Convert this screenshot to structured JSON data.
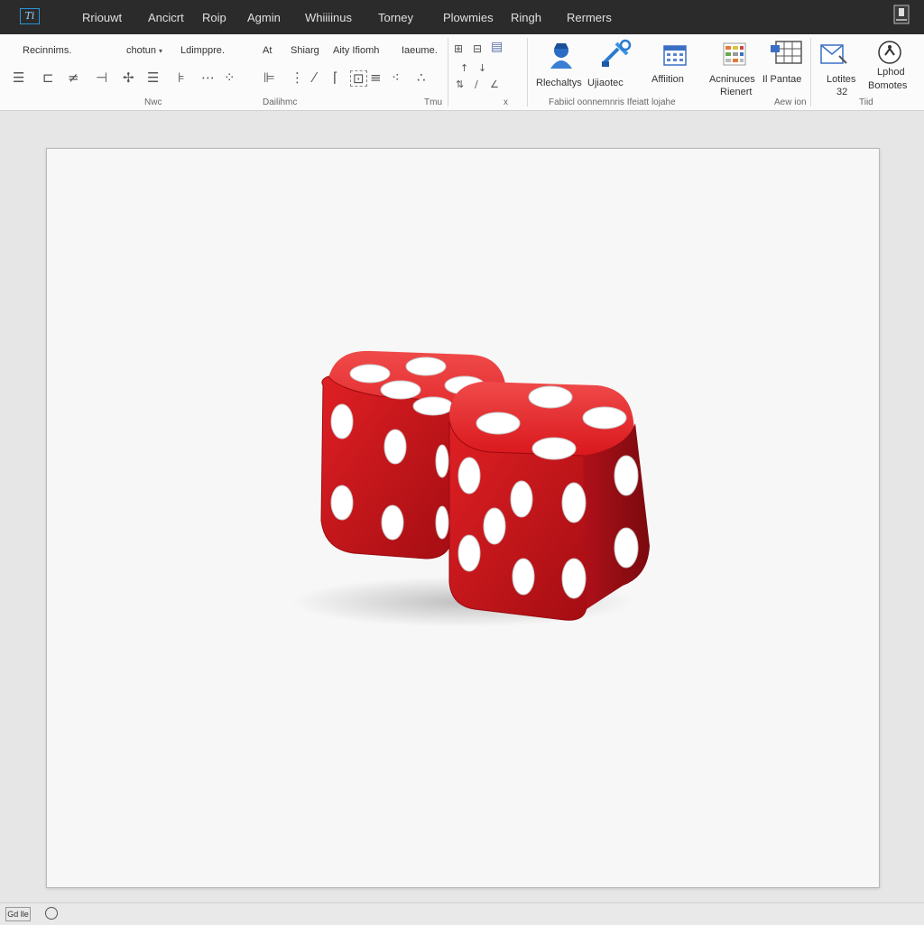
{
  "app": {
    "icon_glyph": "Ti",
    "account_icon": "account-icon"
  },
  "menu": [
    "Rriouwt",
    "Ancicrt",
    "Roip",
    "Agmin",
    "Whiiiinus",
    "Torney",
    "Plowmies",
    "Ringh",
    "Rermers"
  ],
  "ribbon": {
    "labels": {
      "l1": "Recinnims.",
      "l2": "chotun",
      "l3": "Ldimppre.",
      "l4": "At",
      "l5": "Shiarg",
      "l6": "Aity Ifiomh",
      "l7": "Iaeume."
    },
    "groups": {
      "g1": "Nwc",
      "g2": "Dailihmc",
      "g3": "Tmu",
      "g4": "Fabiicl oonnemnris Ifeiatt lojahe",
      "g5": "Aew ion",
      "g6": "Tiid"
    },
    "x_mark": "x",
    "buttons": {
      "b1": "Rlechaltys",
      "b2": "Ujiaotec",
      "b3": "Affiition",
      "b4_line1": "Acninuces",
      "b4_line2": "Rienert",
      "b5": "Il Pantae",
      "b6_line1": "Lotites",
      "b6_line2": "32",
      "b7_line1": "Lphod",
      "b7_line2": "Bomotes"
    }
  },
  "status": {
    "label": "Gd lle"
  },
  "colors": {
    "titlebar": "#2b2b2b",
    "accent": "#2a93d5",
    "die_red": "#d8151a",
    "pip": "#ffffff"
  }
}
